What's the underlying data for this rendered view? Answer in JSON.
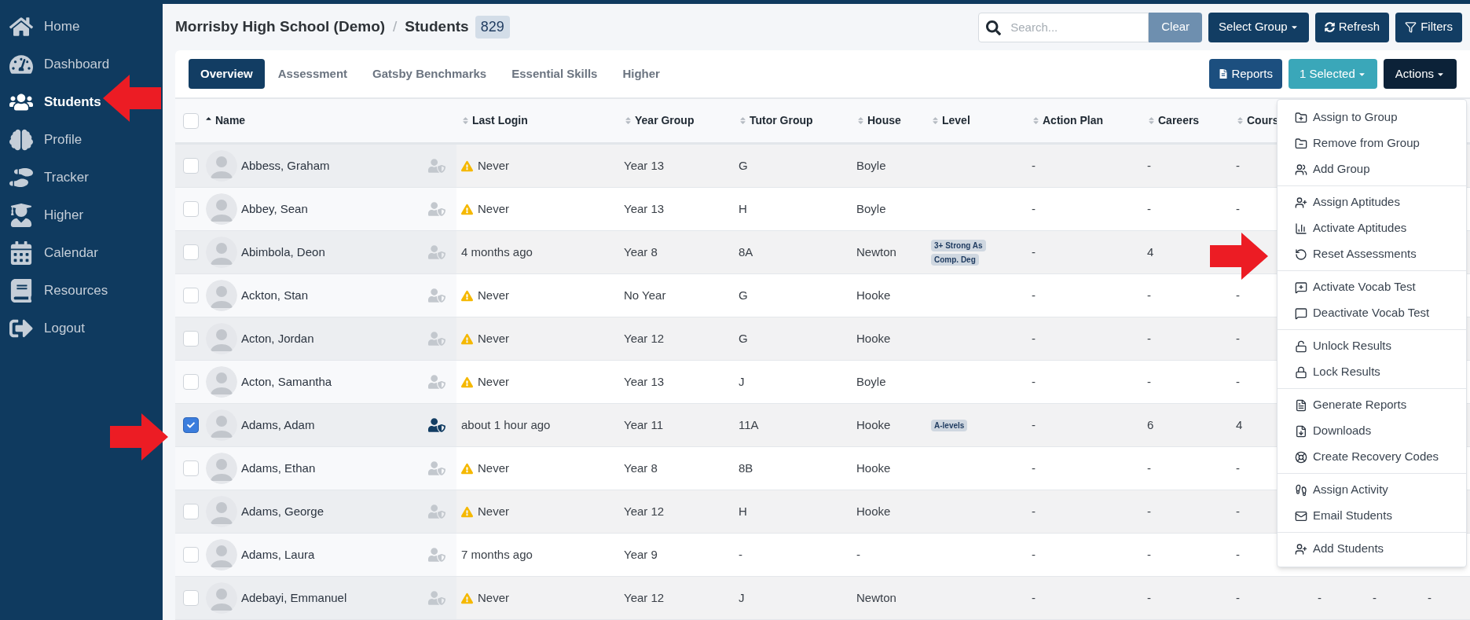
{
  "sidebar": {
    "items": [
      {
        "label": "Home",
        "selected": false
      },
      {
        "label": "Dashboard",
        "selected": false
      },
      {
        "label": "Students",
        "selected": true
      },
      {
        "label": "Profile",
        "selected": false
      },
      {
        "label": "Tracker",
        "selected": false
      },
      {
        "label": "Higher",
        "selected": false
      },
      {
        "label": "Calendar",
        "selected": false
      },
      {
        "label": "Resources",
        "selected": false
      },
      {
        "label": "Logout",
        "selected": false
      }
    ]
  },
  "header": {
    "school": "Morrisby High School (Demo)",
    "separator": "/",
    "page": "Students",
    "count": "829",
    "search": {
      "placeholder": "Search..."
    },
    "clear": "Clear",
    "select_group": "Select Group",
    "refresh": "Refresh",
    "filters": "Filters"
  },
  "tabs": [
    {
      "label": "Overview",
      "selected": true
    },
    {
      "label": "Assessment",
      "selected": false
    },
    {
      "label": "Gatsby Benchmarks",
      "selected": false
    },
    {
      "label": "Essential Skills",
      "selected": false
    },
    {
      "label": "Higher",
      "selected": false
    }
  ],
  "toolbar": {
    "reports": "Reports",
    "selected_count": "1 Selected",
    "actions": "Actions"
  },
  "table": {
    "all_checked": false,
    "columns": [
      {
        "label": "Name",
        "sorted": true
      },
      {
        "label": "Last Login",
        "sorted": false
      },
      {
        "label": "Year Group",
        "sorted": false
      },
      {
        "label": "Tutor Group",
        "sorted": false
      },
      {
        "label": "House",
        "sorted": false
      },
      {
        "label": "Level",
        "sorted": false
      },
      {
        "label": "Action Plan",
        "sorted": false
      },
      {
        "label": "Careers",
        "sorted": false
      },
      {
        "label": "Cours",
        "sorted": false
      }
    ],
    "rows": [
      {
        "selected": false,
        "name": "Abbess, Graham",
        "account_active": false,
        "never": true,
        "last_login": "Never",
        "year_group": "Year 13",
        "tutor_group": "G",
        "house": "Boyle",
        "level_tags": [],
        "action_plan": "-",
        "careers": "-",
        "courses": "-"
      },
      {
        "selected": false,
        "name": "Abbey, Sean",
        "account_active": false,
        "never": true,
        "last_login": "Never",
        "year_group": "Year 13",
        "tutor_group": "H",
        "house": "Boyle",
        "level_tags": [],
        "action_plan": "-",
        "careers": "-",
        "courses": "-"
      },
      {
        "selected": false,
        "name": "Abimbola, Deon",
        "account_active": false,
        "never": false,
        "last_login": "4 months ago",
        "year_group": "Year 8",
        "tutor_group": "8A",
        "house": "Newton",
        "level_tags": [
          "3+ Strong As",
          "Comp. Deg"
        ],
        "action_plan": "-",
        "careers": "4"
      },
      {
        "selected": false,
        "name": "Ackton, Stan",
        "account_active": false,
        "never": true,
        "last_login": "Never",
        "year_group": "No Year",
        "tutor_group": "G",
        "house": "Hooke",
        "level_tags": [],
        "action_plan": "-",
        "careers": "-",
        "courses": "-"
      },
      {
        "selected": false,
        "name": "Acton, Jordan",
        "account_active": false,
        "never": true,
        "last_login": "Never",
        "year_group": "Year 12",
        "tutor_group": "G",
        "house": "Hooke",
        "level_tags": [],
        "action_plan": "-",
        "careers": "-",
        "courses": "-"
      },
      {
        "selected": false,
        "name": "Acton, Samantha",
        "account_active": false,
        "never": true,
        "last_login": "Never",
        "year_group": "Year 13",
        "tutor_group": "J",
        "house": "Boyle",
        "level_tags": [],
        "action_plan": "-",
        "careers": "-",
        "courses": "-"
      },
      {
        "selected": true,
        "name": "Adams, Adam",
        "account_active": true,
        "never": false,
        "last_login": "about 1 hour ago",
        "year_group": "Year 11",
        "tutor_group": "11A",
        "house": "Hooke",
        "level_tags": [
          "A-levels"
        ],
        "action_plan": "-",
        "careers": "6",
        "courses": "4"
      },
      {
        "selected": false,
        "name": "Adams, Ethan",
        "account_active": false,
        "never": true,
        "last_login": "Never",
        "year_group": "Year 8",
        "tutor_group": "8B",
        "house": "Hooke",
        "level_tags": [],
        "action_plan": "-",
        "careers": "-",
        "courses": "-"
      },
      {
        "selected": false,
        "name": "Adams, George",
        "account_active": false,
        "never": true,
        "last_login": "Never",
        "year_group": "Year 12",
        "tutor_group": "H",
        "house": "Hooke",
        "level_tags": [],
        "action_plan": "-",
        "careers": "-",
        "courses": "-"
      },
      {
        "selected": false,
        "name": "Adams, Laura",
        "account_active": false,
        "never": false,
        "last_login": "7 months ago",
        "year_group": "Year 9",
        "tutor_group": "-",
        "house": "-",
        "level_tags": [],
        "action_plan": "-",
        "careers": "-",
        "courses": "-"
      },
      {
        "selected": false,
        "name": "Adebayi, Emmanuel",
        "account_active": false,
        "never": true,
        "last_login": "Never",
        "year_group": "Year 12",
        "tutor_group": "J",
        "house": "Newton",
        "level_tags": [],
        "action_plan": "-",
        "careers": "-",
        "courses": "-",
        "extra": [
          "-",
          "-",
          "-"
        ]
      }
    ]
  },
  "actions_menu": {
    "sections": [
      [
        "Assign to Group",
        "Remove from Group",
        "Add Group"
      ],
      [
        "Assign Aptitudes",
        "Activate Aptitudes",
        "Reset Assessments"
      ],
      [
        "Activate Vocab Test",
        "Deactivate Vocab Test"
      ],
      [
        "Unlock Results",
        "Lock Results"
      ],
      [
        "Generate Reports",
        "Downloads",
        "Create Recovery Codes"
      ],
      [
        "Assign Activity",
        "Email Students"
      ],
      [
        "Add Students"
      ]
    ]
  }
}
